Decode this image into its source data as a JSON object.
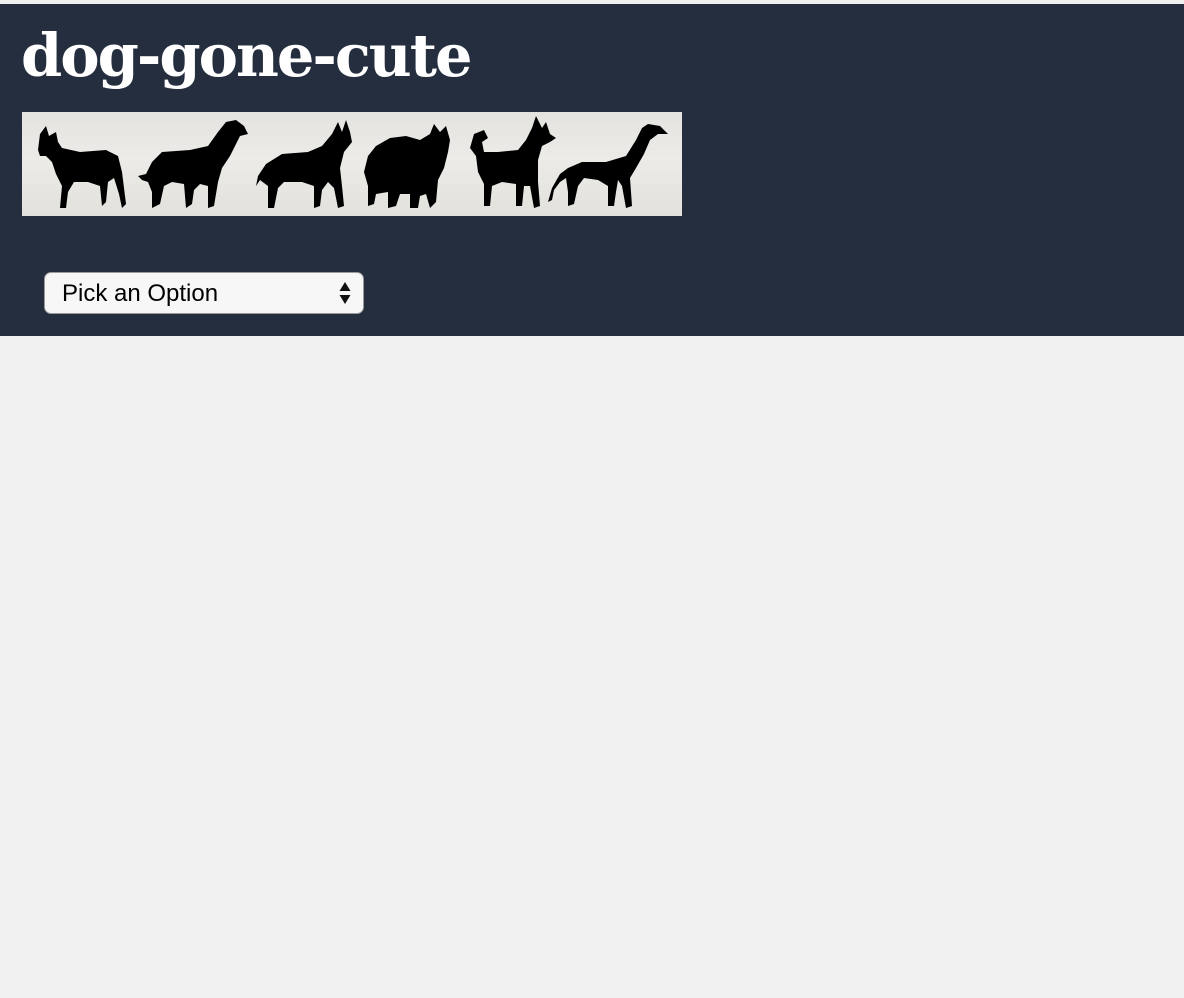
{
  "header": {
    "title": "dog-gone-cute",
    "background_color": "#252e3f",
    "title_color": "#ffffff"
  },
  "banner": {
    "icons": [
      "dog-silhouette-icon",
      "dog-silhouette-icon",
      "dog-silhouette-icon",
      "dog-silhouette-icon",
      "dog-silhouette-icon",
      "dog-silhouette-icon"
    ]
  },
  "breed_select": {
    "selected_label": "Pick an Option",
    "icon": "updown-arrows-icon"
  },
  "page": {
    "background_color": "#f0f0f0"
  }
}
